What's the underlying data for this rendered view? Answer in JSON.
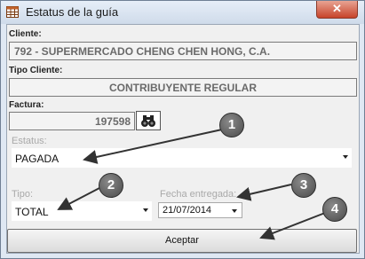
{
  "window": {
    "title": "Estatus de la guía",
    "close_label": "✕"
  },
  "form": {
    "cliente_label": "Cliente:",
    "cliente_value": "792 - SUPERMERCADO CHENG CHEN HONG, C.A.",
    "tipo_cliente_label": "Tipo Cliente:",
    "tipo_cliente_value": "CONTRIBUYENTE REGULAR",
    "factura_label": "Factura:",
    "factura_value": "197598",
    "estatus_label": "Estatus:",
    "estatus_value": "PAGADA",
    "tipo_label": "Tipo:",
    "tipo_value": "TOTAL",
    "fecha_label": "Fecha entregada:",
    "fecha_value": "21/07/2014"
  },
  "buttons": {
    "accept_label": "Aceptar"
  },
  "callouts": [
    "1",
    "2",
    "3",
    "4"
  ]
}
